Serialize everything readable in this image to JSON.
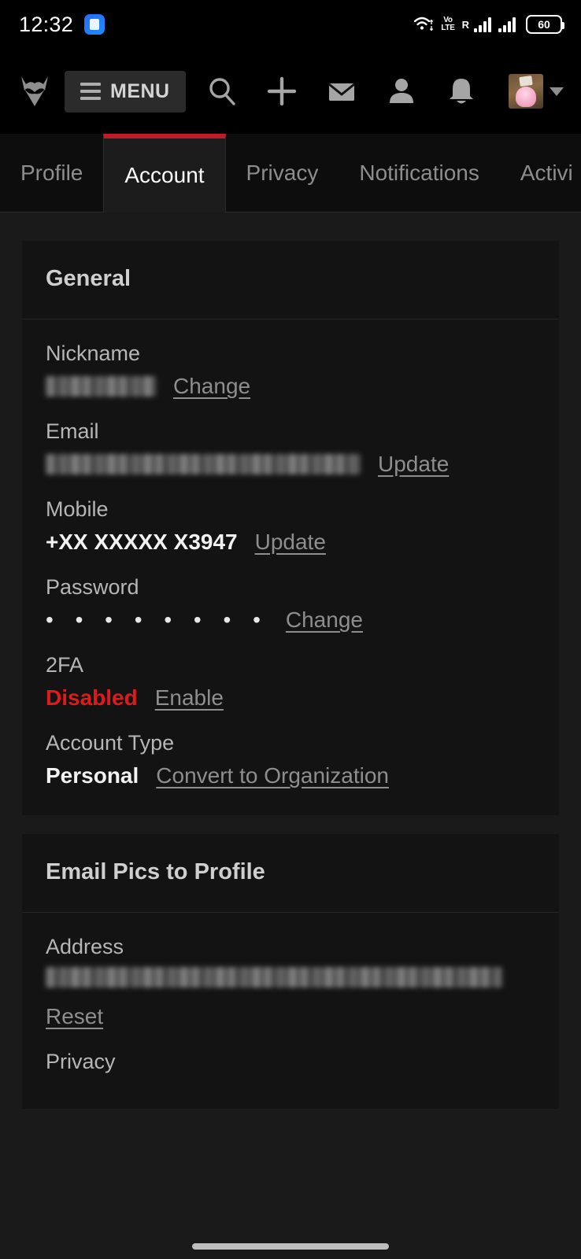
{
  "statusbar": {
    "time": "12:32",
    "app_icon": "message-icon",
    "wifi_icon": "wifi-icon",
    "volte_line1": "Vo",
    "volte_line2": "LTE",
    "roaming": "R",
    "signal_icon_1": "signal-bars-icon",
    "signal_icon_2": "signal-bars-icon",
    "battery_level": "60"
  },
  "topnav": {
    "logo_name": "site-logo",
    "menu_label": "MENU",
    "icons": [
      {
        "name": "search-icon"
      },
      {
        "name": "plus-icon"
      },
      {
        "name": "envelope-icon"
      },
      {
        "name": "person-icon"
      },
      {
        "name": "bell-icon"
      }
    ],
    "avatar_name": "user-avatar",
    "caret_name": "chevron-down-icon"
  },
  "tabs": [
    {
      "label": "Profile",
      "active": false
    },
    {
      "label": "Account",
      "active": true
    },
    {
      "label": "Privacy",
      "active": false
    },
    {
      "label": "Notifications",
      "active": false
    },
    {
      "label": "Activi",
      "active": false
    }
  ],
  "general_card": {
    "title": "General",
    "nickname": {
      "label": "Nickname",
      "value": "",
      "redacted": true,
      "action": "Change"
    },
    "email": {
      "label": "Email",
      "value": "",
      "redacted": true,
      "action": "Update"
    },
    "mobile": {
      "label": "Mobile",
      "value": "+XX XXXXX X3947",
      "action": "Update"
    },
    "password": {
      "label": "Password",
      "value": "• • • • • • • •",
      "action": "Change"
    },
    "twofa": {
      "label": "2FA",
      "value": "Disabled",
      "action": "Enable",
      "value_color": "#e0191b"
    },
    "account_type": {
      "label": "Account Type",
      "value": "Personal",
      "action": "Convert to Organization"
    }
  },
  "email_pics_card": {
    "title": "Email Pics to Profile",
    "address": {
      "label": "Address",
      "value": "",
      "redacted": true,
      "action": "Reset"
    },
    "privacy": {
      "label": "Privacy"
    }
  },
  "colors": {
    "accent_red": "#c01c28",
    "danger_red": "#e0191b",
    "page_bg": "#1a1a1a",
    "card_bg": "#131313",
    "nav_bg": "#000000"
  }
}
